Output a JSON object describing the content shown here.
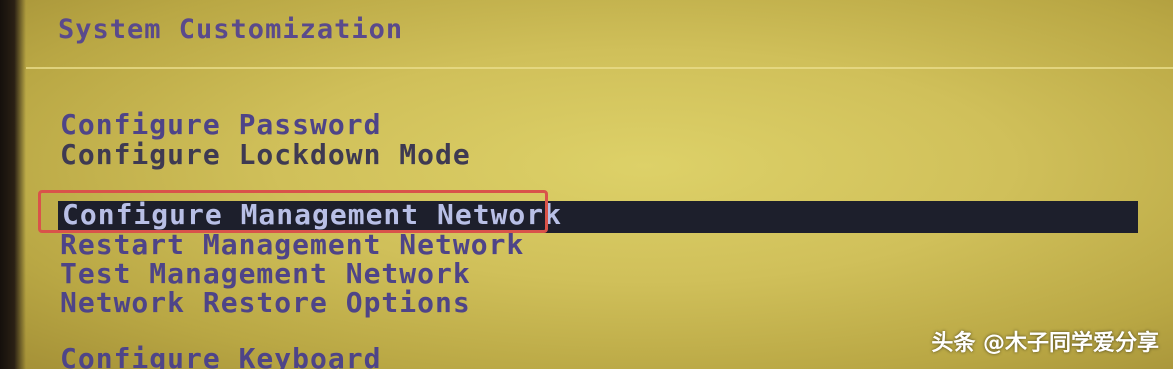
{
  "screen": {
    "title": "System Customization"
  },
  "menu": {
    "items": [
      {
        "label": "Configure Password"
      },
      {
        "label": "Configure Lockdown Mode"
      },
      {
        "label": "Configure Management Network"
      },
      {
        "label": "Restart Management Network"
      },
      {
        "label": "Test Management Network"
      },
      {
        "label": "Network Restore Options"
      },
      {
        "label": "Configure Keyboard"
      }
    ],
    "selected_index": 2
  },
  "watermark": {
    "text": "头条 @木子同学爱分享"
  },
  "colors": {
    "background": "#d0c05a",
    "title_text": "#5a4a8c",
    "menu_text": "#3e3a52",
    "highlight_bar": "#1d1f2c",
    "highlight_text": "#b8bfe6",
    "annotation_box": "#d9534a"
  }
}
